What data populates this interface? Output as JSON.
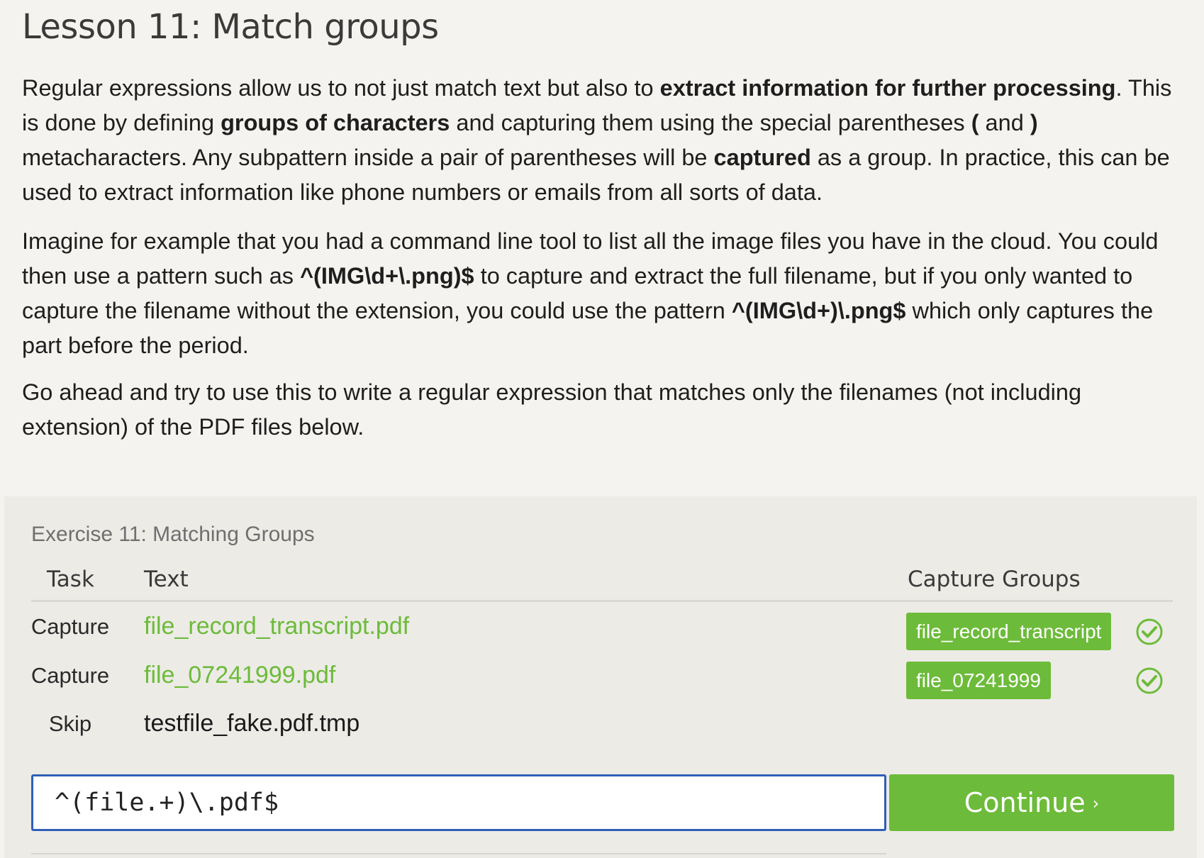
{
  "lesson": {
    "title": "Lesson 11: Match groups",
    "p1": {
      "t1": "Regular expressions allow us to not just match text but also to ",
      "b1": "extract information for further processing",
      "t2": ". This is done by defining ",
      "b2": "groups of characters",
      "t3": " and capturing them using the special parentheses ",
      "b3": "(",
      "t4": " and ",
      "b4": ")",
      "t5": " metacharacters. Any subpattern inside a pair of parentheses will be ",
      "b5": "captured",
      "t6": " as a group. In practice, this can be used to extract information like phone numbers or emails from all sorts of data."
    },
    "p2": {
      "t1": "Imagine for example that you had a command line tool to list all the image files you have in the cloud. You could then use a pattern such as ",
      "b1": "^(IMG\\d+\\.png)$",
      "t2": " to capture and extract the full filename, but if you only wanted to capture the filename without the extension, you could use the pattern ",
      "b2": "^(IMG\\d+)\\.png$",
      "t3": " which only captures the part before the period."
    },
    "p3": "Go ahead and try to use this to write a regular expression that matches only the filenames (not including extension) of the PDF files below."
  },
  "exercise": {
    "title": "Exercise 11: Matching Groups",
    "headers": {
      "task": "Task",
      "text": "Text",
      "groups": "Capture Groups"
    },
    "rows": [
      {
        "task": "Capture",
        "text": "file_record_transcript.pdf",
        "group": "file_record_transcript",
        "status": "success"
      },
      {
        "task": "Capture",
        "text": "file_07241999.pdf",
        "group": "file_07241999",
        "status": "success"
      },
      {
        "task": "Skip",
        "text": "testfile_fake.pdf.tmp"
      }
    ],
    "input_value": "^(file.+)\\.pdf$",
    "continue_label": "Continue",
    "continue_arrow": "›",
    "accent_color": "#6dbb3a",
    "input_border_color": "#2f5fb8"
  }
}
